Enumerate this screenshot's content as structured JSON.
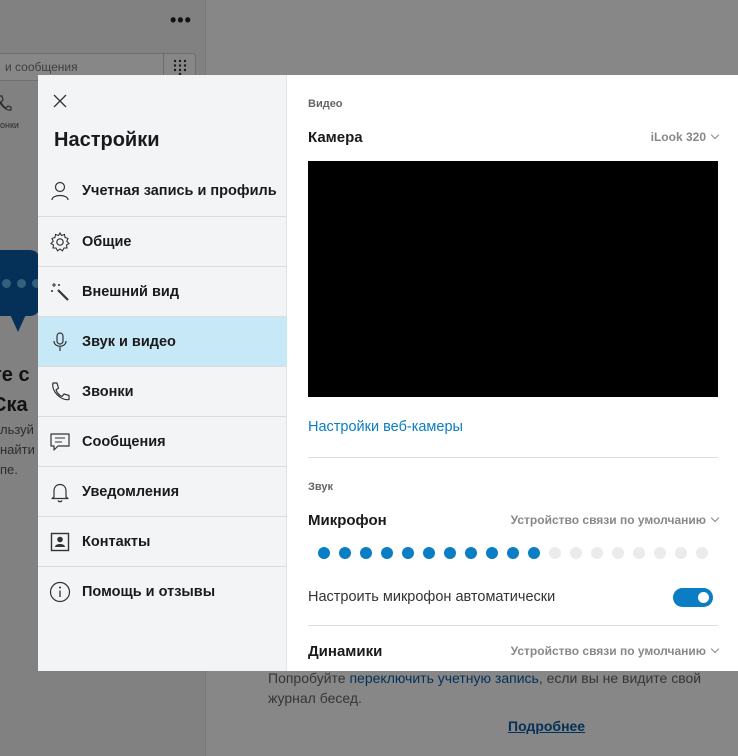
{
  "background": {
    "search_placeholder": "и сообщения",
    "more_menu": "•••",
    "calls_label": "онки",
    "heading_fragment": "те с\nСка",
    "small_text": "льзуй\nнайти\nпе.",
    "bottom_text_pre": "Попробуйте ",
    "bottom_link": "переключить учетную запись",
    "bottom_text_post": ", если вы не видите свой журнал бесед.",
    "more_link": "Подробнее"
  },
  "nav": {
    "title": "Настройки",
    "items": [
      {
        "label": "Учетная запись и профиль",
        "icon": "person-icon"
      },
      {
        "label": "Общие",
        "icon": "gear-icon"
      },
      {
        "label": "Внешний вид",
        "icon": "magic-wand-icon"
      },
      {
        "label": "Звук и видео",
        "icon": "microphone-icon",
        "active": true
      },
      {
        "label": "Звонки",
        "icon": "phone-icon"
      },
      {
        "label": "Сообщения",
        "icon": "message-icon"
      },
      {
        "label": "Уведомления",
        "icon": "bell-icon"
      },
      {
        "label": "Контакты",
        "icon": "contact-card-icon"
      },
      {
        "label": "Помощь и отзывы",
        "icon": "info-icon"
      }
    ]
  },
  "video": {
    "section_label": "Видео",
    "camera_label": "Камера",
    "camera_device": "iLook 320",
    "webcam_settings_link": "Настройки веб-камеры"
  },
  "audio": {
    "section_label": "Звук",
    "microphone_label": "Микрофон",
    "microphone_device": "Устройство связи по умолчанию",
    "mic_level": {
      "active_dots": 11,
      "total_dots": 19
    },
    "auto_adjust_label": "Настроить микрофон автоматически",
    "auto_adjust_enabled": true,
    "speakers_label": "Динамики",
    "speakers_device": "Устройство связи по умолчанию"
  },
  "colors": {
    "accent": "#0b7dc4",
    "active_nav_bg": "#c6e8f7",
    "nav_bg": "#f3f4f6"
  }
}
